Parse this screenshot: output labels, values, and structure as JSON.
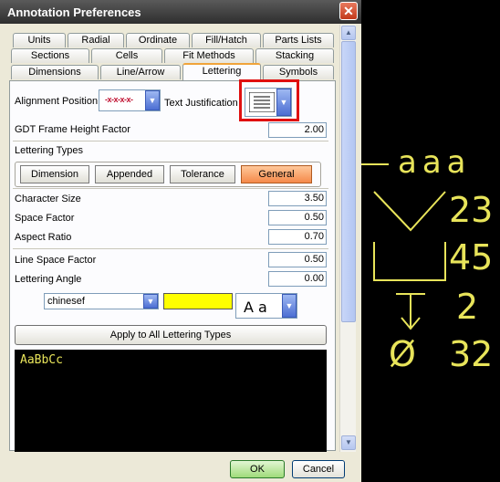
{
  "window": {
    "title": "Annotation Preferences",
    "close_glyph": "✕"
  },
  "tabs": {
    "row1": [
      "Units",
      "Radial",
      "Ordinate",
      "Fill/Hatch",
      "Parts Lists"
    ],
    "row2": [
      "Sections",
      "Cells",
      "Fit Methods",
      "Stacking"
    ],
    "row3": [
      "Dimensions",
      "Line/Arrow",
      "Lettering",
      "Symbols"
    ],
    "active": "Lettering"
  },
  "lettering": {
    "alignment_label": "Alignment Position",
    "alignment_value": "-x-x-x-x-",
    "justification_label": "Text Justification",
    "gdt_label": "GDT Frame Height Factor",
    "gdt_value": "2.00",
    "types_label": "Lettering Types",
    "types": [
      "Dimension",
      "Appended",
      "Tolerance",
      "General"
    ],
    "active_type": "General",
    "char_size_label": "Character Size",
    "char_size_value": "3.50",
    "space_factor_label": "Space Factor",
    "space_factor_value": "0.50",
    "aspect_ratio_label": "Aspect Ratio",
    "aspect_ratio_value": "0.70",
    "line_space_label": "Line Space Factor",
    "line_space_value": "0.50",
    "angle_label": "Lettering Angle",
    "angle_value": "0.00",
    "font_value": "chinesef",
    "color_value": "#ffff00",
    "style_value": "A a",
    "apply_label": "Apply to All Lettering Types",
    "preview_text": "AaBbCc"
  },
  "footer": {
    "ok_label": "OK",
    "cancel_label": "Cancel"
  },
  "canvas": {
    "appended_text": "aaa",
    "depth_value": "23",
    "square_value": "45",
    "depth_symbol_value": "2",
    "diameter_value": "32",
    "diameter_symbol": "Ø"
  },
  "colors": {
    "accent": "#f0a43a",
    "highlight": "#e01010",
    "cad_yellow": "#e8e45a"
  }
}
